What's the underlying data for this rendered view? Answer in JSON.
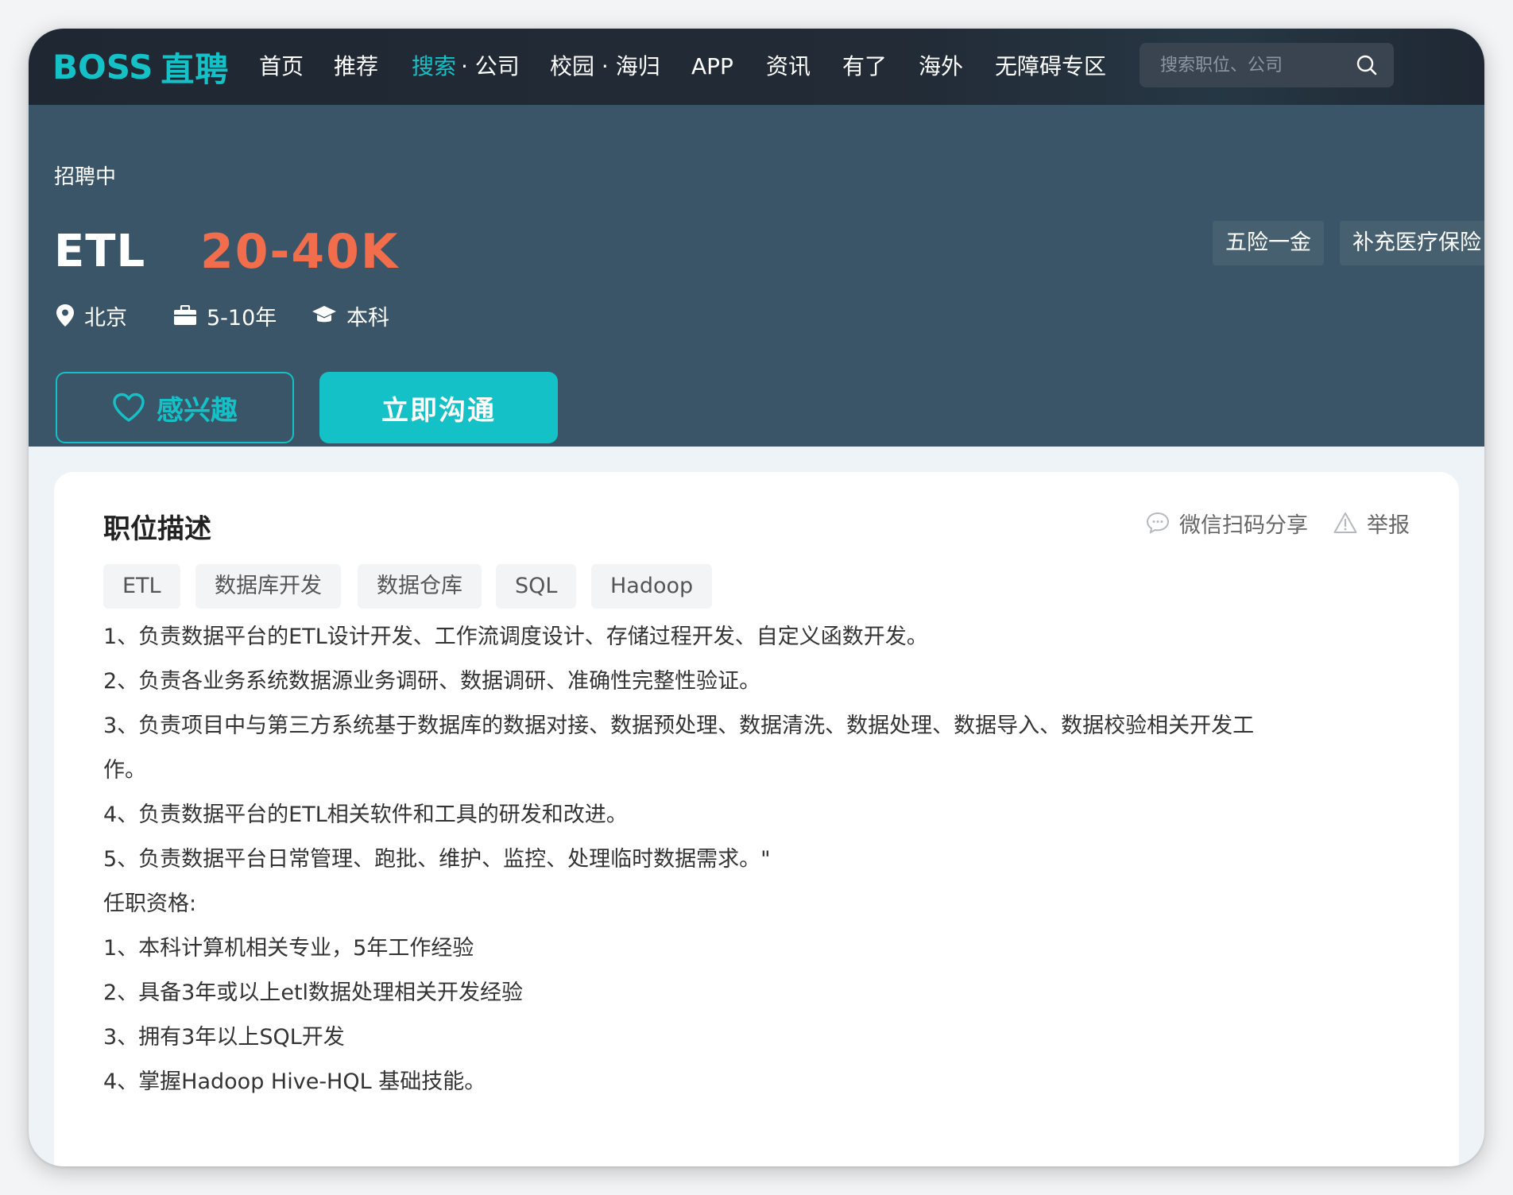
{
  "nav": {
    "logo_boss": "BOSS",
    "logo_zhipin": "直聘",
    "items": [
      {
        "label": "首页"
      },
      {
        "label": "推荐"
      },
      {
        "label": "搜索"
      },
      {
        "label": "· 公司"
      },
      {
        "label": "校园 · 海归"
      },
      {
        "label": "APP"
      },
      {
        "label": "资讯"
      },
      {
        "label": "有了"
      },
      {
        "label": "海外"
      },
      {
        "label": "无障碍专区"
      }
    ],
    "search_placeholder": "搜索职位、公司"
  },
  "job": {
    "status": "招聘中",
    "title": "ETL",
    "salary": "20-40K",
    "benefits": [
      "五险一金",
      "补充医疗保险"
    ],
    "location": "北京",
    "experience": "5-10年",
    "education": "本科",
    "interest_label": "感兴趣",
    "chat_label": "立即沟通"
  },
  "description": {
    "title": "职位描述",
    "share_label": "微信扫码分享",
    "report_label": "举报",
    "tags": [
      "ETL",
      "数据库开发",
      "数据仓库",
      "SQL",
      "Hadoop"
    ],
    "lines": [
      "1、负责数据平台的ETL设计开发、工作流调度设计、存储过程开发、自定义函数开发。",
      "2、负责各业务系统数据源业务调研、数据调研、准确性完整性验证。",
      "3、负责项目中与第三方系统基于数据库的数据对接、数据预处理、数据清洗、数据处理、数据导入、数据校验相关开发工",
      "作。",
      "4、负责数据平台的ETL相关软件和工具的研发和改进。",
      "5、负责数据平台日常管理、跑批、维护、监控、处理临时数据需求。\"",
      "任职资格:",
      "1、本科计算机相关专业，5年工作经验",
      "2、具备3年或以上etl数据处理相关开发经验",
      "3、拥有3年以上SQL开发",
      "4、掌握Hadoop Hive-HQL 基础技能。"
    ]
  },
  "colors": {
    "accent": "#14c1c7",
    "salary": "#f26d4b",
    "header_bg": "#3b5568",
    "nav_bg": "#222b36"
  }
}
